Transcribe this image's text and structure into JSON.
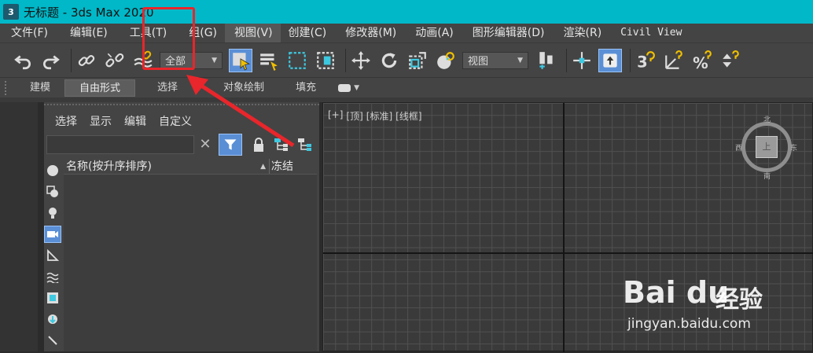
{
  "titlebar": {
    "icon_text": "3",
    "title": "无标题 - 3ds Max 2020"
  },
  "menu": {
    "items": [
      "文件(F)",
      "编辑(E)",
      "工具(T)",
      "组(G)",
      "视图(V)",
      "创建(C)",
      "修改器(M)",
      "动画(A)",
      "图形编辑器(D)",
      "渲染(R)",
      "Civil View"
    ]
  },
  "toolbar": {
    "selection_filter": "全部",
    "reference_coord": "视图"
  },
  "ribbon": {
    "tabs": [
      "建模",
      "自由形式",
      "选择",
      "对象绘制",
      "填充"
    ]
  },
  "scene_explorer": {
    "menu": [
      "选择",
      "显示",
      "编辑",
      "自定义"
    ],
    "search_value": "",
    "col_name": "名称(按升序排序)",
    "col_freeze": "冻结"
  },
  "viewport": {
    "labels": [
      "[+]",
      "[顶]",
      "[标准]",
      "[线框]"
    ],
    "viewcube": {
      "face": "上",
      "n": "北",
      "s": "南",
      "w": "西",
      "e": "东"
    }
  },
  "watermark": {
    "logo": "Bai du",
    "cn": "经验",
    "url": "jingyan.baidu.com"
  },
  "colors": {
    "titlebar": "#00b8c8",
    "highlight": "#e8262b",
    "active_button": "#5a8fd6"
  }
}
